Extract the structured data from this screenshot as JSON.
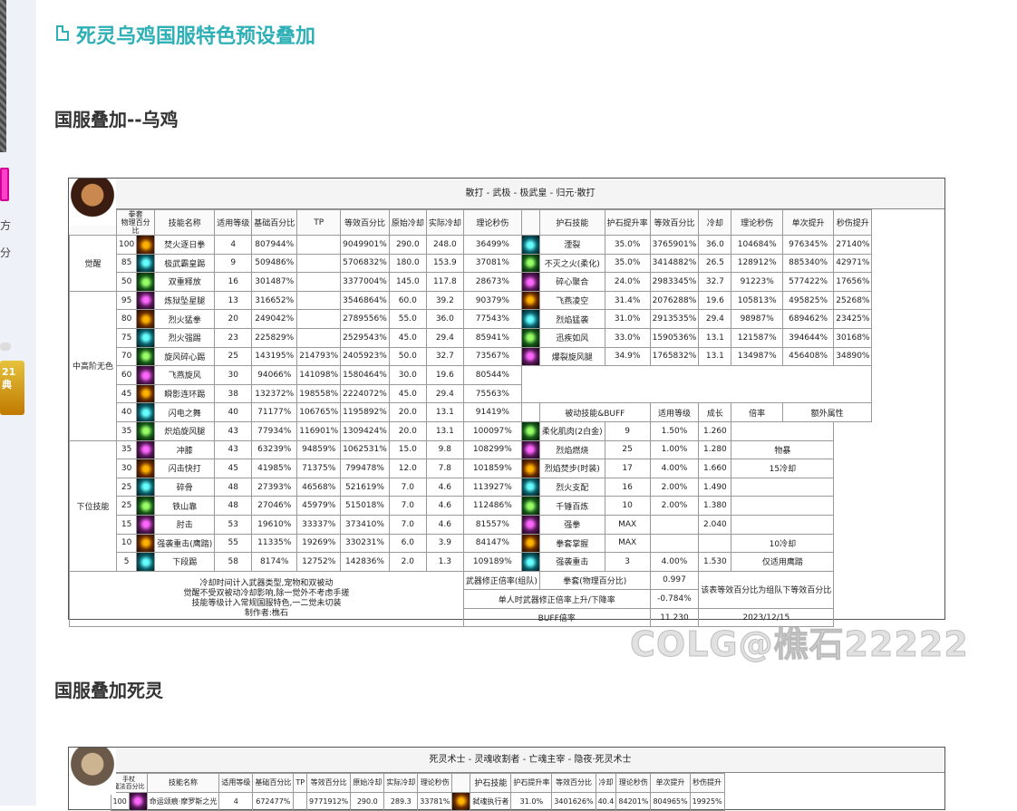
{
  "sidebar": {
    "text1": "方",
    "text2": "分",
    "badge_line1": "21",
    "badge_line2": "典"
  },
  "page": {
    "title": "死灵乌鸡国服特色预设叠加",
    "section1": "国服叠加--乌鸡",
    "section2": "国服叠加死灵",
    "watermark": "COLG@樵石22222"
  },
  "sheet1": {
    "title": "散打 - 武极 - 极武皇 - 归元·散打",
    "headers": [
      "拳套\n物理百分比",
      "技能名称",
      "适用等级",
      "基础百分比",
      "TP",
      "等效百分比",
      "原始冷却",
      "实际冷却",
      "理论秒伤",
      "护石技能",
      "护石提升率",
      "等效百分比",
      "冷却",
      "理论秒伤",
      "单次提升",
      "秒伤提升"
    ],
    "groups": [
      {
        "name": "觉醒",
        "rows": 3
      },
      {
        "name": "中高阶无色",
        "rows": 8
      },
      {
        "name": "下位技能",
        "rows": 7
      }
    ],
    "skills": [
      [
        "100",
        "焚火逐日拳",
        "4",
        "807944%",
        "",
        "9049901%",
        "290.0",
        "248.0",
        "36499%"
      ],
      [
        "85",
        "极武霸皇踢",
        "9",
        "509486%",
        "",
        "5706832%",
        "180.0",
        "153.9",
        "37081%"
      ],
      [
        "50",
        "双重释放",
        "16",
        "301487%",
        "",
        "3377004%",
        "145.0",
        "117.8",
        "28673%"
      ],
      [
        "95",
        "炼狱坠星腿",
        "13",
        "316652%",
        "",
        "3546864%",
        "60.0",
        "39.2",
        "90379%"
      ],
      [
        "80",
        "烈火猛拳",
        "20",
        "249042%",
        "",
        "2789556%",
        "55.0",
        "36.0",
        "77543%"
      ],
      [
        "75",
        "烈火强踢",
        "23",
        "225829%",
        "",
        "2529543%",
        "45.0",
        "29.4",
        "85941%"
      ],
      [
        "70",
        "旋风碎心踢",
        "25",
        "143195%",
        "214793%",
        "2405923%",
        "50.0",
        "32.7",
        "73567%"
      ],
      [
        "60",
        "飞燕旋风",
        "30",
        "94066%",
        "141098%",
        "1580464%",
        "30.0",
        "19.6",
        "80544%"
      ],
      [
        "45",
        "瞬影连环踢",
        "38",
        "132372%",
        "198558%",
        "2224072%",
        "45.0",
        "29.4",
        "75563%"
      ],
      [
        "40",
        "闪电之舞",
        "40",
        "71177%",
        "106765%",
        "1195892%",
        "20.0",
        "13.1",
        "91419%"
      ],
      [
        "35",
        "炽焰旋风腿",
        "43",
        "77934%",
        "116901%",
        "1309424%",
        "20.0",
        "13.1",
        "100097%"
      ],
      [
        "35",
        "冲膝",
        "43",
        "63239%",
        "94859%",
        "1062531%",
        "15.0",
        "9.8",
        "108299%"
      ],
      [
        "30",
        "闪击快打",
        "45",
        "41985%",
        "71375%",
        "799478%",
        "12.0",
        "7.8",
        "101859%"
      ],
      [
        "25",
        "碎骨",
        "48",
        "27393%",
        "46568%",
        "521619%",
        "7.0",
        "4.6",
        "113927%"
      ],
      [
        "25",
        "铁山靠",
        "48",
        "27046%",
        "45979%",
        "515018%",
        "7.0",
        "4.6",
        "112486%"
      ],
      [
        "15",
        "肘击",
        "53",
        "19610%",
        "33337%",
        "373410%",
        "7.0",
        "4.6",
        "81557%"
      ],
      [
        "10",
        "强袭重击(鹰踏)",
        "55",
        "11335%",
        "19269%",
        "330231%",
        "6.0",
        "3.9",
        "84147%"
      ],
      [
        "5",
        "下段踢",
        "58",
        "8174%",
        "12752%",
        "142836%",
        "2.0",
        "1.3",
        "109189%"
      ]
    ],
    "talismans": [
      [
        "湮裂",
        "35.0%",
        "3765901%",
        "36.0",
        "104684%",
        "976345%",
        "27140%"
      ],
      [
        "不灭之火(柔化)",
        "35.0%",
        "3414882%",
        "26.5",
        "128912%",
        "885340%",
        "42971%"
      ],
      [
        "碎心聚合",
        "24.0%",
        "2983345%",
        "32.7",
        "91223%",
        "577422%",
        "17656%"
      ],
      [
        "飞燕凌空",
        "31.4%",
        "2076288%",
        "19.6",
        "105813%",
        "495825%",
        "25268%"
      ],
      [
        "烈焰猛袭",
        "31.0%",
        "2913535%",
        "29.4",
        "98987%",
        "689462%",
        "23425%"
      ],
      [
        "迅疾如风",
        "33.0%",
        "1590536%",
        "13.1",
        "121587%",
        "394644%",
        "30168%"
      ],
      [
        "爆裂旋风腿",
        "34.9%",
        "1765832%",
        "13.1",
        "134987%",
        "456408%",
        "34890%"
      ]
    ],
    "passive_headers": [
      "被动技能&BUFF",
      "适用等级",
      "成长",
      "倍率",
      "额外属性"
    ],
    "passives": [
      [
        "柔化肌肉(2白金)",
        "9",
        "1.50%",
        "1.260",
        ""
      ],
      [
        "烈焰燃烧",
        "25",
        "1.00%",
        "1.280",
        "物暴"
      ],
      [
        "烈焰焚步(时装)",
        "17",
        "4.00%",
        "1.660",
        "15冷却"
      ],
      [
        "烈火支配",
        "16",
        "2.00%",
        "1.490",
        ""
      ],
      [
        "千锤百炼",
        "10",
        "2.00%",
        "1.380",
        ""
      ],
      [
        "强拳",
        "MAX",
        "",
        "2.040",
        ""
      ],
      [
        "拳套掌握",
        "MAX",
        "",
        "",
        "10冷却"
      ],
      [
        "强袭重击",
        "3",
        "4.00%",
        "1.530",
        "仅适用鹰踏"
      ]
    ],
    "notes": [
      "冷却时间计入武器类型,宠物和双被动",
      "觉醒不受双被动冷却影响,除一觉外不考虑手搓",
      "技能等级计入常规国服特色,一二觉未切装",
      "制作者:樵石"
    ],
    "weapon_label": "武器修正倍率(组队)",
    "weapon_type": "拳套(物理百分比)",
    "weapon_value": "0.997",
    "single_label": "单人时武器修正倍率上升/下降率",
    "single_value": "-0.784%",
    "buff_label": "BUFF倍率",
    "buff_value": "11.230",
    "note_right": "该表等效百分比为组队下等效百分比",
    "date": "2023/12/15"
  },
  "sheet2": {
    "title": "死灵术士 - 灵魂收割者 - 亡魂主宰 - 隐夜·死灵术士",
    "headers": [
      "手杖\n魔法百分比",
      "技能名称",
      "适用等级",
      "基础百分比",
      "TP",
      "等效百分比",
      "原始冷却",
      "实际冷却",
      "理论秒伤",
      "护石技能",
      "护石提升率",
      "等效百分比",
      "冷却",
      "理论秒伤",
      "单次提升",
      "秒伤提升"
    ],
    "row": [
      "100",
      "命运颂痕·摩罗斯之光",
      "4",
      "672477%",
      "",
      "9771912%",
      "290.0",
      "289.3",
      "33781%",
      "弑魂执行者",
      "31.0%",
      "3401626%",
      "40.4",
      "84201%",
      "804965%",
      "19925%"
    ]
  }
}
